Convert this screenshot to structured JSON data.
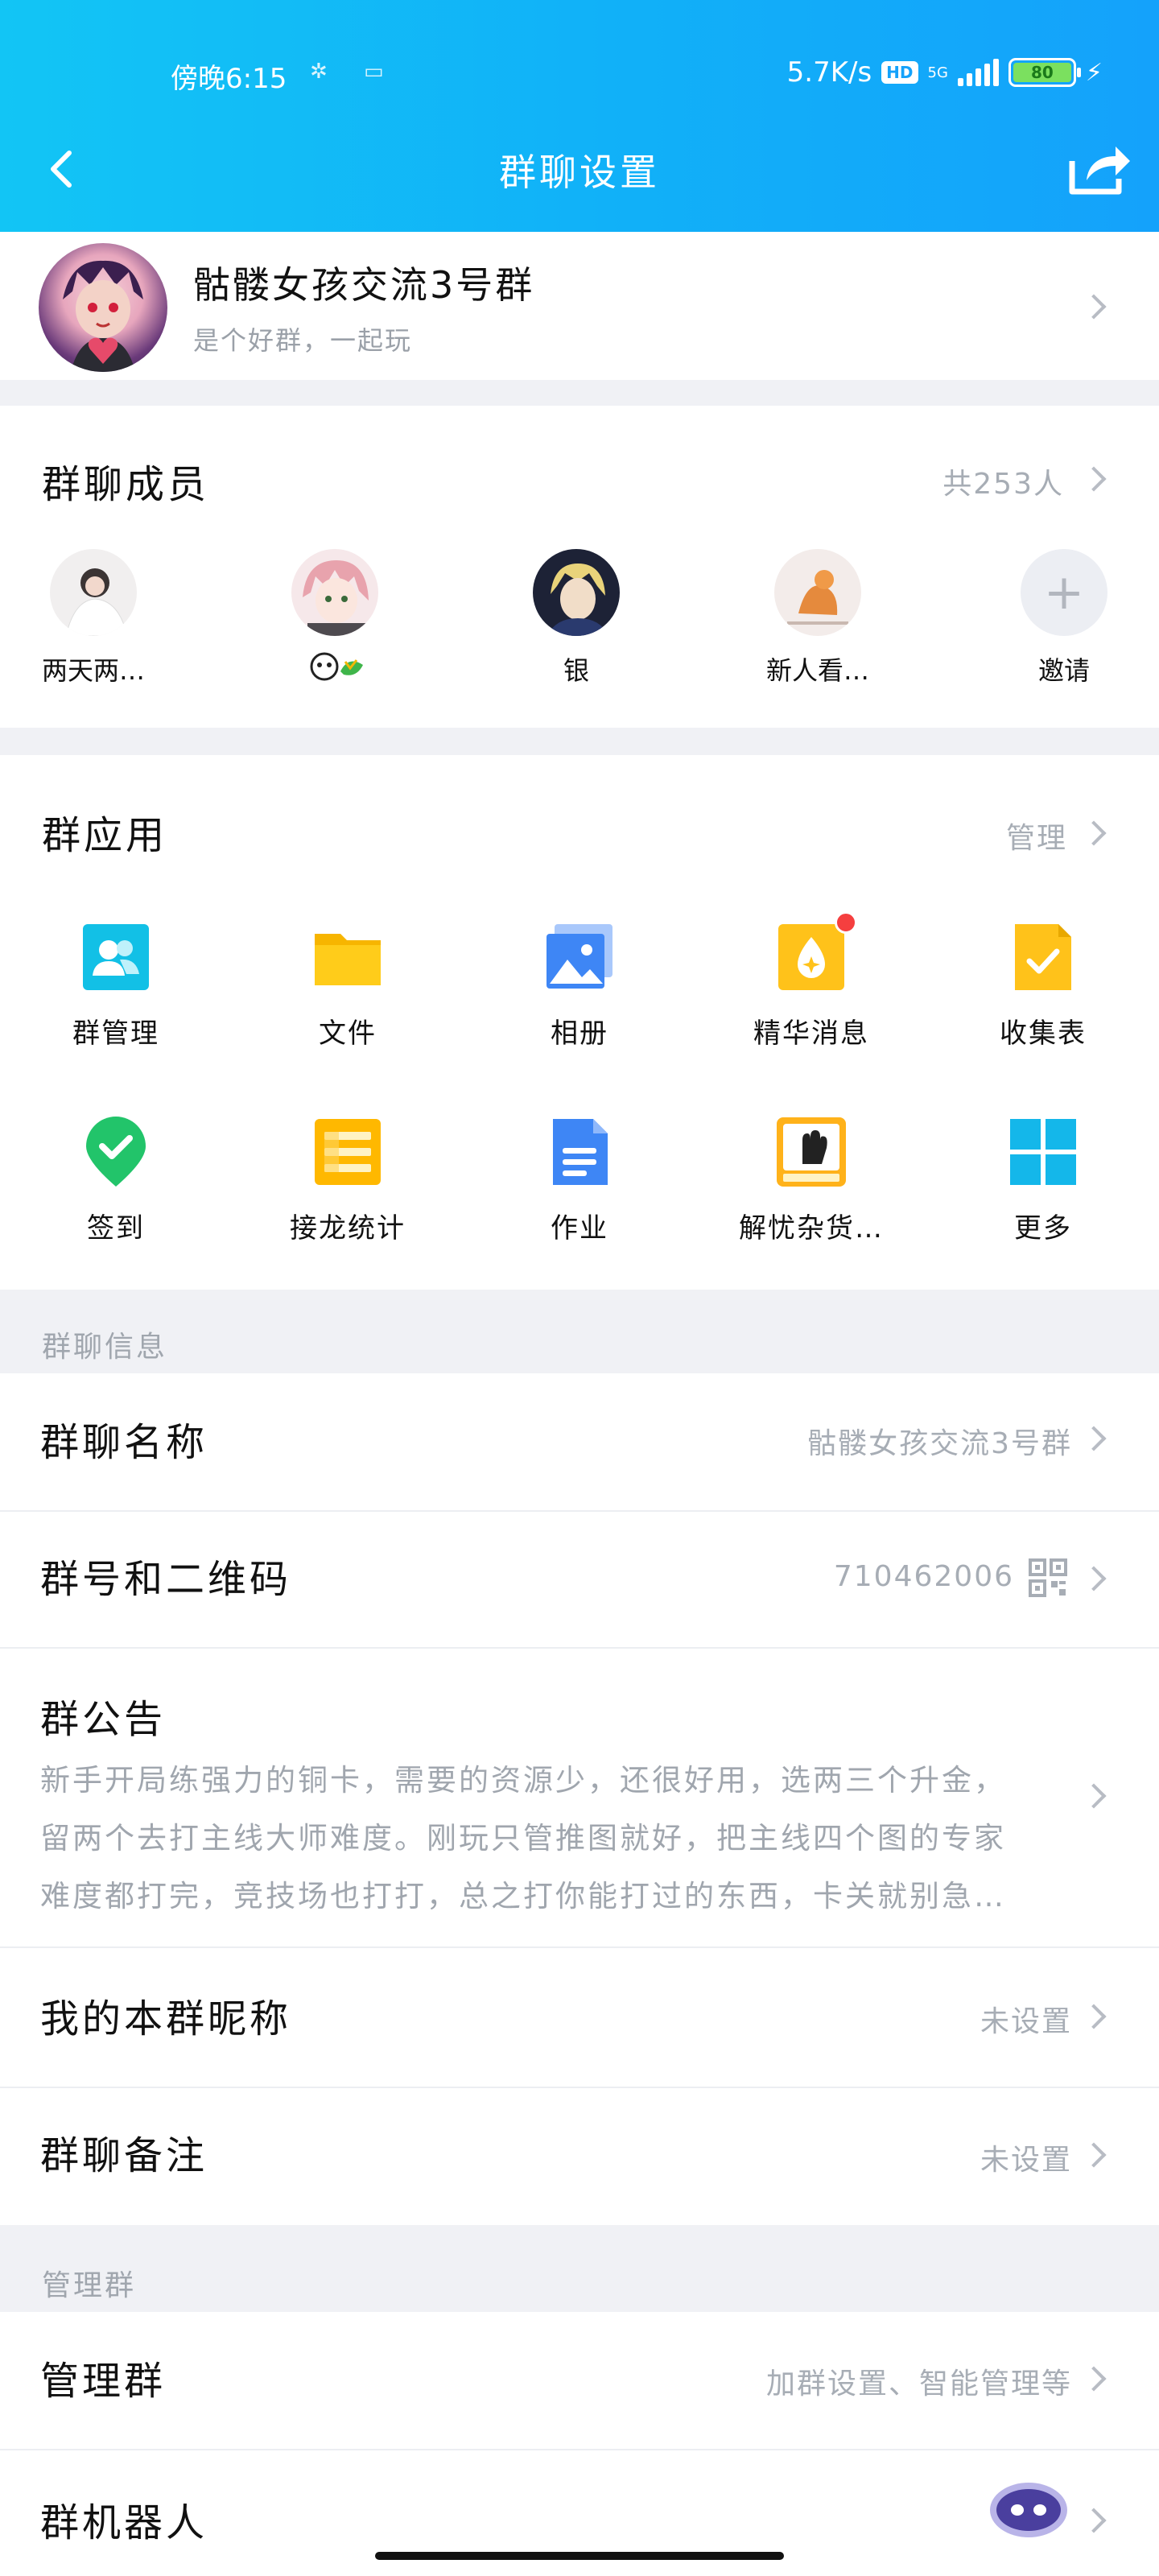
{
  "status_bar": {
    "time": "傍晚6:15",
    "net_speed": "5.7K/s",
    "hd": "HD",
    "network": "5G",
    "battery": "80"
  },
  "nav": {
    "title": "群聊设置"
  },
  "group": {
    "name": "骷髅女孩交流3号群",
    "description": "是个好群，一起玩"
  },
  "members": {
    "title": "群聊成员",
    "count": "共253人",
    "items": [
      {
        "label": "两天两…"
      },
      {
        "label": ""
      },
      {
        "label": "银"
      },
      {
        "label": "新人看…"
      },
      {
        "label": "邀请"
      }
    ]
  },
  "apps": {
    "title": "群应用",
    "manage": "管理",
    "items": [
      {
        "label": "群管理",
        "icon": "group-manage-icon"
      },
      {
        "label": "文件",
        "icon": "folder-icon"
      },
      {
        "label": "相册",
        "icon": "album-icon"
      },
      {
        "label": "精华消息",
        "icon": "essence-icon"
      },
      {
        "label": "收集表",
        "icon": "form-icon"
      },
      {
        "label": "签到",
        "icon": "checkin-icon"
      },
      {
        "label": "接龙统计",
        "icon": "relay-icon"
      },
      {
        "label": "作业",
        "icon": "homework-icon"
      },
      {
        "label": "解忧杂货…",
        "icon": "grocery-icon"
      },
      {
        "label": "更多",
        "icon": "more-grid-icon"
      }
    ]
  },
  "info": {
    "section": "群聊信息",
    "group_name_label": "群聊名称",
    "group_name_value": "骷髅女孩交流3号群",
    "group_id_label": "群号和二维码",
    "group_id_value": "710462006",
    "notice_label": "群公告",
    "notice_lines": [
      "新手开局练强力的铜卡，需要的资源少，还很好用，选两三个升金，",
      "留两个去打主线大师难度。刚玩只管推图就好，把主线四个图的专家",
      "难度都打完，竞技场也打打，总之打你能打过的东西，卡关就别急…"
    ],
    "nickname_label": "我的本群昵称",
    "nickname_value": "未设置",
    "remark_label": "群聊备注",
    "remark_value": "未设置"
  },
  "manage": {
    "section": "管理群",
    "manage_label": "管理群",
    "manage_value": "加群设置、智能管理等",
    "robot_label": "群机器人"
  },
  "colors": {
    "accent": "#12b4f7",
    "muted": "#a7adb5",
    "background": "#f0f1f5"
  }
}
